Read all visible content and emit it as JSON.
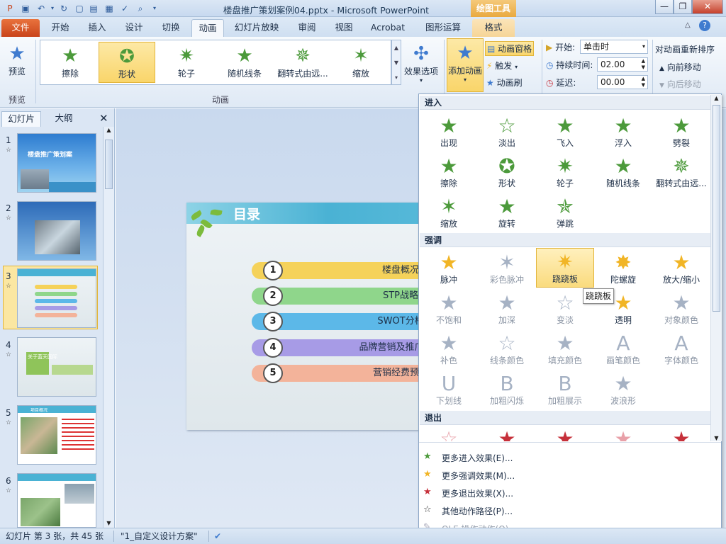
{
  "window": {
    "title": "楼盘推广策划案例04.pptx - Microsoft PowerPoint",
    "context_tool": "绘图工具",
    "controls": [
      "—",
      "❐",
      "✕"
    ]
  },
  "tabs": [
    "文件",
    "开始",
    "插入",
    "设计",
    "切换",
    "动画",
    "幻灯片放映",
    "审阅",
    "视图",
    "Acrobat",
    "图形运算",
    "格式"
  ],
  "ribbon": {
    "preview_label": "预览",
    "preview_group": "预览",
    "anim_group": "动画",
    "gallery": [
      "擦除",
      "形状",
      "轮子",
      "随机线条",
      "翻转式由远...",
      "缩放"
    ],
    "effect_options": "效果选项",
    "add_animation": "添加动画",
    "anim_pane": "动画窗格",
    "trigger": "触发",
    "anim_painter": "动画刷",
    "start_label": "开始:",
    "start_value": "单击时",
    "duration_label": "持续时间:",
    "duration_value": "02.00",
    "delay_label": "延迟:",
    "delay_value": "00.00",
    "reorder": "对动画重新排序",
    "move_earlier": "向前移动",
    "move_later": "向后移动"
  },
  "panel": {
    "tab_slides": "幻灯片",
    "tab_outline": "大纲",
    "close": "✕",
    "slides": [
      "1",
      "2",
      "3",
      "4",
      "5",
      "6"
    ],
    "thumb1_title": "楼盘推广策划案",
    "thumb4_title": "关于蓝天国际",
    "thumb5_title": "项目概况"
  },
  "slide": {
    "title": "目录",
    "items": [
      {
        "num": "1",
        "text": "楼盘概况",
        "color": "#f5d25a"
      },
      {
        "num": "2",
        "text": "STP战略",
        "color": "#8fd68b"
      },
      {
        "num": "3",
        "text": "SWOT分析",
        "color": "#5cb8e8"
      },
      {
        "num": "4",
        "text": "品牌营销及推广战略",
        "color": "#a79be6"
      },
      {
        "num": "5",
        "text": "营销经费预算",
        "color": "#f3b39a"
      }
    ]
  },
  "dropdown": {
    "sec_entrance": "进入",
    "sec_emphasis": "强调",
    "sec_exit": "退出",
    "entrance": [
      "出现",
      "淡出",
      "飞入",
      "浮入",
      "劈裂",
      "擦除",
      "形状",
      "轮子",
      "随机线条",
      "翻转式由远...",
      "缩放",
      "旋转",
      "弹跳"
    ],
    "emphasis": [
      "脉冲",
      "彩色脉冲",
      "跷跷板",
      "陀螺旋",
      "放大/缩小",
      "不饱和",
      "加深",
      "变淡",
      "透明",
      "对象颜色",
      "补色",
      "线条颜色",
      "填充颜色",
      "画笔颜色",
      "字体颜色",
      "下划线",
      "加粗闪烁",
      "加粗展示",
      "波浪形"
    ],
    "tooltip": "跷跷板",
    "more_entrance": "更多进入效果(E)...",
    "more_emphasis": "更多强调效果(M)...",
    "more_exit": "更多退出效果(X)...",
    "more_paths": "其他动作路径(P)...",
    "ole": "OLE 操作动作(O)..."
  },
  "status": {
    "slide_info": "幻灯片 第 3 张，共 45 张",
    "theme": "\"1_自定义设计方案\""
  }
}
